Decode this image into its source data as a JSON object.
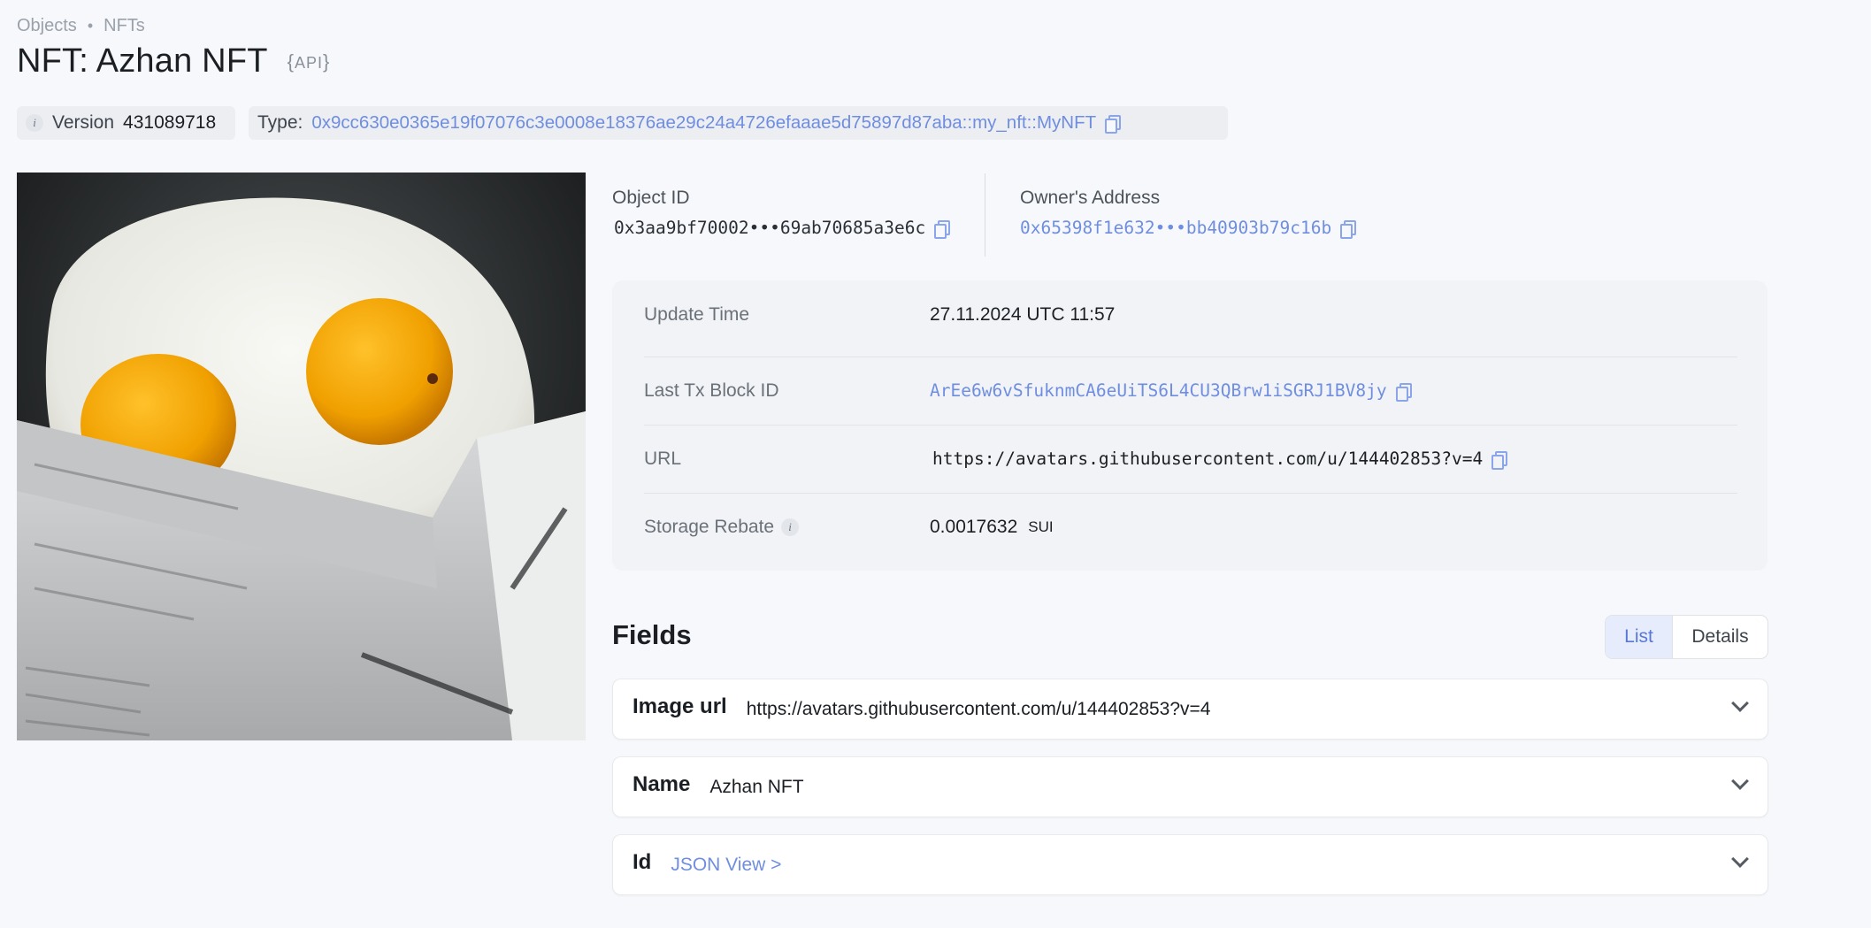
{
  "breadcrumb": {
    "items": [
      "Objects",
      "NFTs"
    ],
    "separator": "•"
  },
  "page": {
    "title": "NFT: Azhan NFT",
    "api_badge": "API"
  },
  "meta": {
    "version_label": "Version",
    "version_value": "431089718",
    "type_label": "Type:",
    "type_value": "0x9cc630e0365e19f07076c3e0008e18376ae29c24a4726efaaae5d75897d87aba::my_nft::MyNFT"
  },
  "object": {
    "id_label": "Object ID",
    "id_value": "0x3aa9bf70002•••69ab70685a3e6c",
    "owner_label": "Owner's Address",
    "owner_value": "0x65398f1e632•••bb40903b79c16b"
  },
  "details": {
    "update_time_label": "Update Time",
    "update_time_value": "27.11.2024 UTC 11:57",
    "last_tx_label": "Last Tx Block ID",
    "last_tx_value": "ArEe6w6vSfuknmCA6eUiTS6L4CU3QBrw1iSGRJ1BV8jy",
    "url_label": "URL",
    "url_value": "https://avatars.githubusercontent.com/u/144402853?v=4",
    "storage_rebate_label": "Storage Rebate",
    "storage_rebate_value": "0.0017632",
    "storage_rebate_unit": "SUI"
  },
  "fields": {
    "title": "Fields",
    "view_list": "List",
    "view_details": "Details",
    "items": [
      {
        "key": "Image url",
        "value": "https://avatars.githubusercontent.com/u/144402853?v=4"
      },
      {
        "key": "Name",
        "value": "Azhan NFT"
      },
      {
        "key": "Id",
        "value": "JSON View >"
      }
    ]
  },
  "colors": {
    "accent": "#6f8ee0",
    "background": "#f7f8fb",
    "panel": "#f1f3f7"
  },
  "image": {
    "icon": "nft-image",
    "subject": "fried eggs in newspaper"
  }
}
